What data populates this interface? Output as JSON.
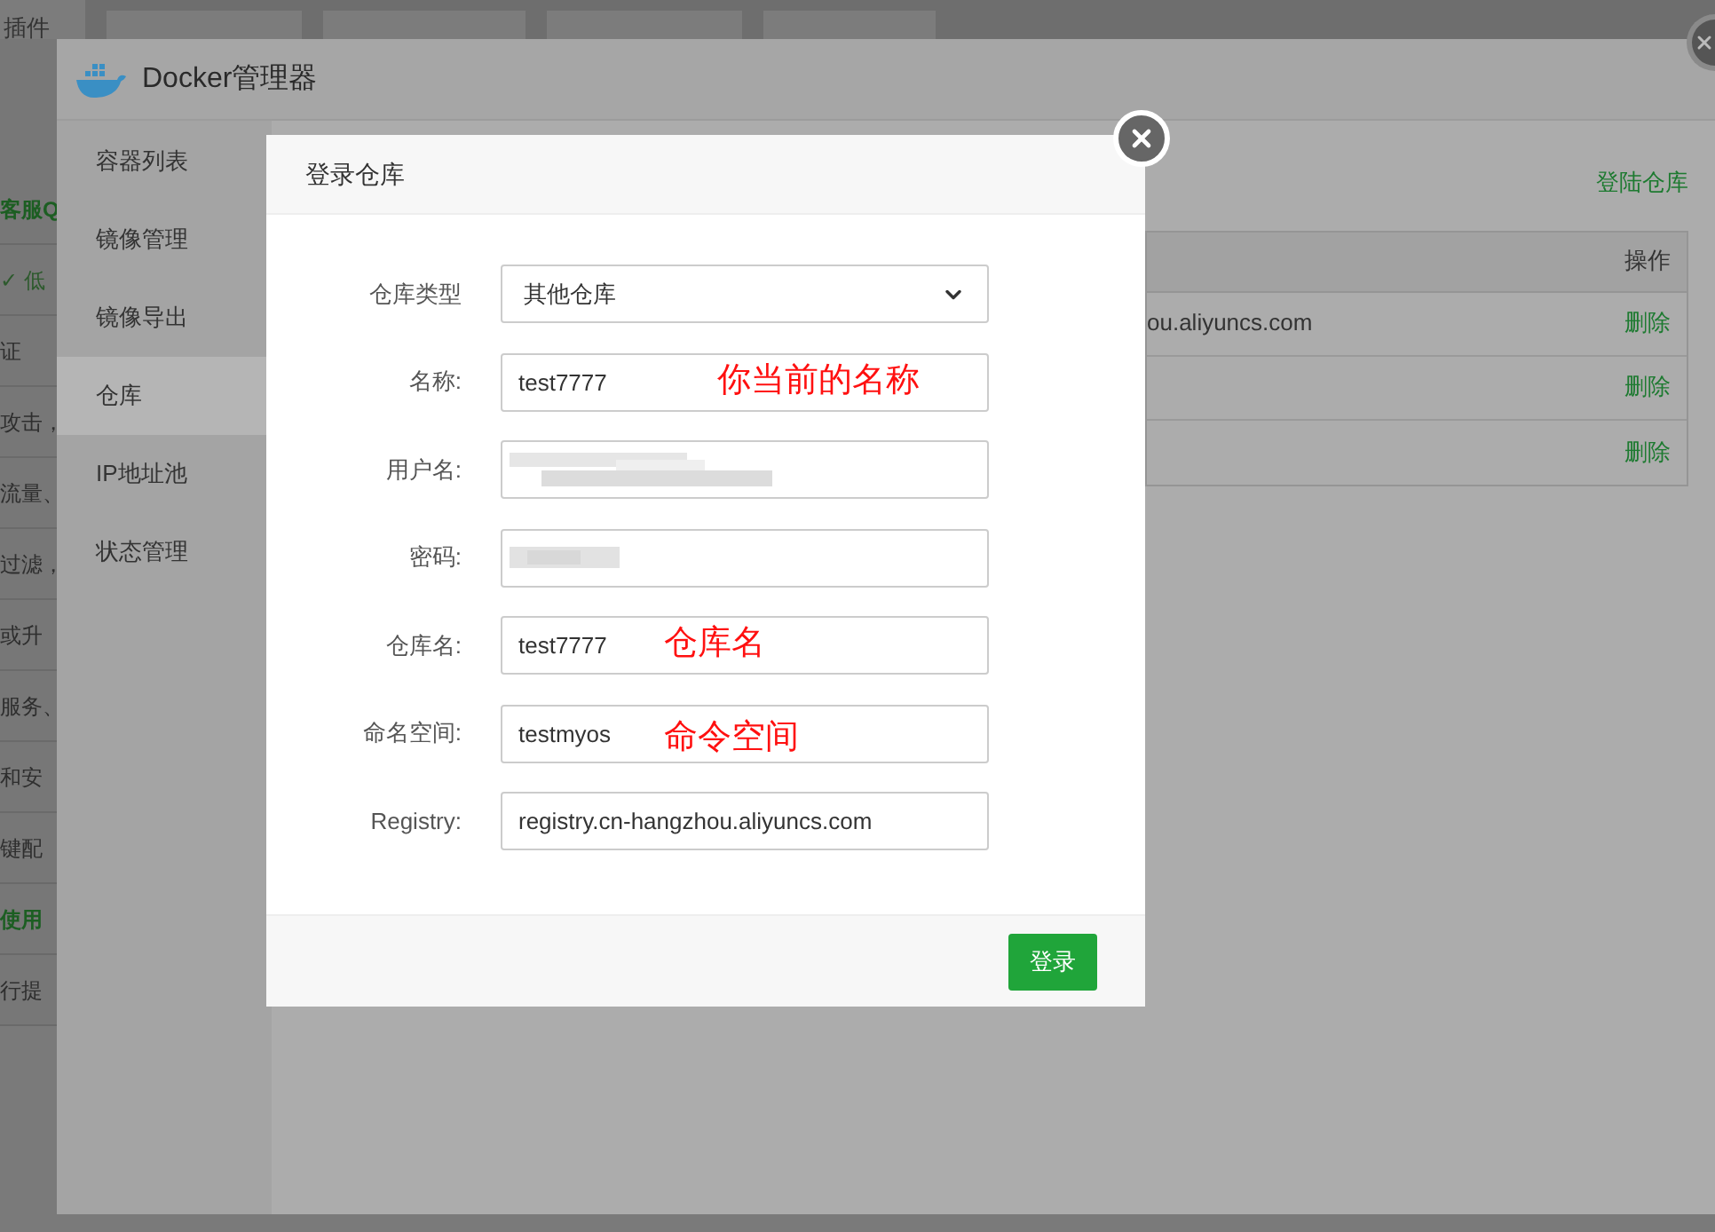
{
  "background_page": {
    "tabs": [
      {
        "label": "插件"
      }
    ],
    "side_texts": [
      {
        "text": "客服Q",
        "kind": "link"
      },
      {
        "text": "✓ 低",
        "kind": "check"
      },
      {
        "text": "证",
        "kind": "plain"
      },
      {
        "text": "攻击，",
        "kind": "plain"
      },
      {
        "text": "流量、",
        "kind": "plain"
      },
      {
        "text": "过滤，",
        "kind": "plain"
      },
      {
        "text": "或升",
        "kind": "plain"
      },
      {
        "text": "服务、",
        "kind": "plain"
      },
      {
        "text": "和安",
        "kind": "plain"
      },
      {
        "text": "键配",
        "kind": "plain"
      },
      {
        "text": "使用",
        "kind": "link"
      },
      {
        "text": "行提",
        "kind": "plain"
      }
    ]
  },
  "docker_window": {
    "title": "Docker管理器",
    "sidebar": {
      "items": [
        {
          "label": "容器列表",
          "selected": false
        },
        {
          "label": "镜像管理",
          "selected": false
        },
        {
          "label": "镜像导出",
          "selected": false
        },
        {
          "label": "仓库",
          "selected": true
        },
        {
          "label": "IP地址池",
          "selected": false
        },
        {
          "label": "状态管理",
          "selected": false
        }
      ]
    },
    "login_link": "登陆仓库",
    "table": {
      "columns": [
        "操作"
      ],
      "rows": [
        {
          "column_1": "ou.aliyuncs.com",
          "action": "删除"
        },
        {
          "action": "删除"
        },
        {
          "action": "删除"
        }
      ]
    }
  },
  "dialog": {
    "title": "登录仓库",
    "fields": [
      {
        "label": "仓库类型",
        "kind": "select",
        "value": "其他仓库"
      },
      {
        "label": "名称:",
        "kind": "text",
        "value": "test7777",
        "annotation": "你当前的名称"
      },
      {
        "label": "用户名:",
        "kind": "redacted"
      },
      {
        "label": "密码:",
        "kind": "redacted"
      },
      {
        "label": "仓库名:",
        "kind": "text",
        "value": "test7777",
        "annotation": "仓库名"
      },
      {
        "label": "命名空间:",
        "kind": "text",
        "value": "testmyos",
        "annotation": "命令空间"
      },
      {
        "label": "Registry:",
        "kind": "text",
        "value": "registry.cn-hangzhou.aliyuncs.com"
      }
    ],
    "submit": "登录"
  }
}
